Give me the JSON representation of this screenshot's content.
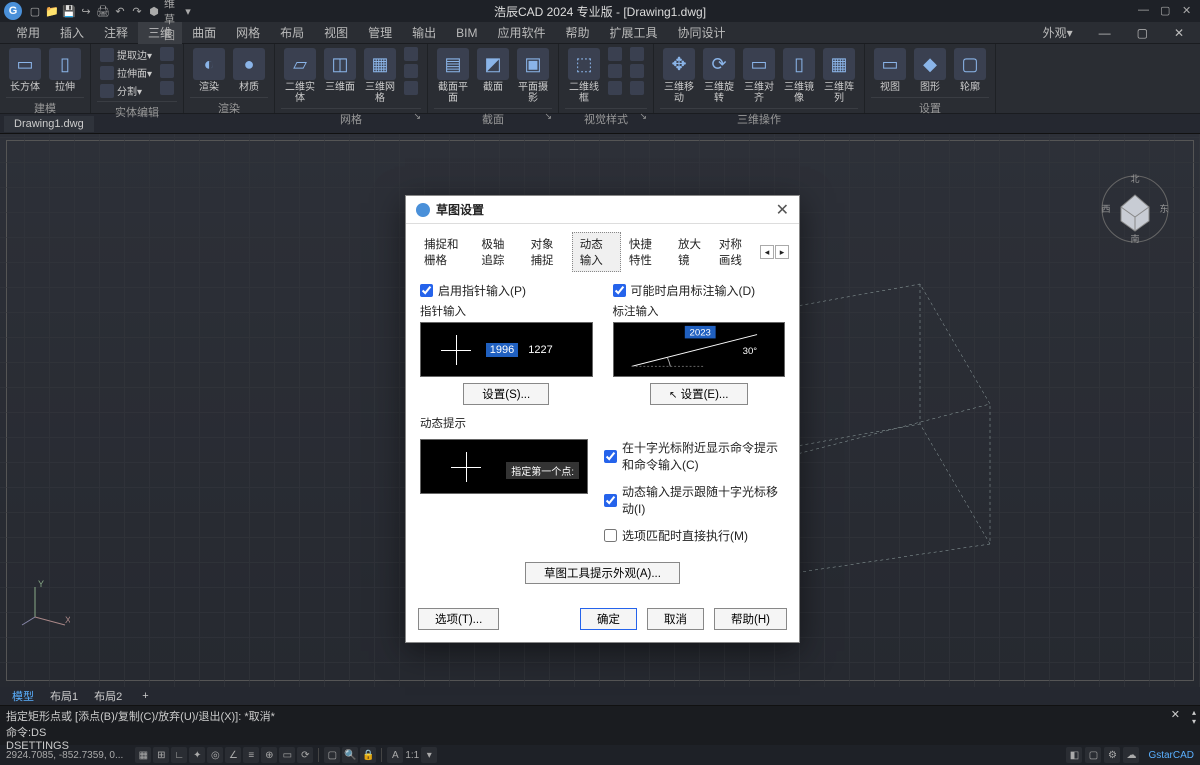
{
  "titlebar": {
    "sketch_mode": "二维草图",
    "app_title": "浩辰CAD 2024 专业版 - [Drawing1.dwg]"
  },
  "menubar": {
    "items": [
      "常用",
      "插入",
      "注释",
      "三维",
      "曲面",
      "网格",
      "布局",
      "视图",
      "管理",
      "输出",
      "BIM",
      "应用软件",
      "帮助",
      "扩展工具",
      "协同设计"
    ],
    "active_index": 3,
    "appearance": "外观▾"
  },
  "ribbon": {
    "groups": [
      {
        "label": "建模",
        "tools": [
          {
            "t": "长方体",
            "big": true
          },
          {
            "t": "拉伸",
            "big": true
          }
        ]
      },
      {
        "label": "实体编辑",
        "tools": [
          {
            "t": "提取边▾"
          },
          {
            "t": "拉伸面▾"
          },
          {
            "t": "分割▾"
          }
        ]
      },
      {
        "label": "渲染",
        "tools": [
          {
            "t": "渲染",
            "big": true
          },
          {
            "t": "材质",
            "big": true
          }
        ]
      },
      {
        "label": "网格",
        "tools": [
          {
            "t": "二维实体",
            "big": true
          },
          {
            "t": "三维面",
            "big": true
          },
          {
            "t": "三维网格",
            "big": true
          }
        ],
        "exp": "↘"
      },
      {
        "label": "截面",
        "tools": [
          {
            "t": "截面平面",
            "big": true
          },
          {
            "t": "截面",
            "big": true
          },
          {
            "t": "平面摄影",
            "big": true
          }
        ],
        "exp": "↘"
      },
      {
        "label": "视觉样式",
        "tools": [
          {
            "t": "二维线框",
            "big": true
          }
        ],
        "exp": "↘"
      },
      {
        "label": "三维操作",
        "tools": [
          {
            "t": "三维移动",
            "big": true
          },
          {
            "t": "三维旋转",
            "big": true
          },
          {
            "t": "三维对齐",
            "big": true
          },
          {
            "t": "三维镜像",
            "big": true
          },
          {
            "t": "三维阵列",
            "big": true
          }
        ]
      },
      {
        "label": "设置",
        "tools": [
          {
            "t": "视图",
            "big": true
          },
          {
            "t": "图形",
            "big": true
          },
          {
            "t": "轮廓",
            "big": true
          }
        ]
      }
    ]
  },
  "doctabs": {
    "items": [
      "Drawing1.dwg"
    ]
  },
  "dialog": {
    "title": "草图设置",
    "tabs": [
      "捕捉和栅格",
      "极轴追踪",
      "对象捕捉",
      "动态输入",
      "快捷特性",
      "放大镜",
      "对称画线"
    ],
    "active_tab": 3,
    "enable_pointer": "启用指针输入(P)",
    "enable_dim": "可能时启用标注输入(D)",
    "pointer_label": "指针输入",
    "dim_label": "标注输入",
    "val1": "1996",
    "val2": "1227",
    "val3": "2023",
    "angle": "30°",
    "settings_s": "设置(S)...",
    "settings_e": "设置(E)...",
    "dyn_prompt_label": "动态提示",
    "prompt_text": "指定第一个点:",
    "chk_crosshair": "在十字光标附近显示命令提示和命令输入(C)",
    "chk_follow": "动态输入提示跟随十字光标移动(I)",
    "chk_match": "选项匹配时直接执行(M)",
    "appearance_btn": "草图工具提示外观(A)...",
    "options_btn": "选项(T)...",
    "ok": "确定",
    "cancel": "取消",
    "help": "帮助(H)"
  },
  "layouttabs": {
    "items": [
      "模型",
      "布局1",
      "布局2"
    ],
    "active": 0
  },
  "cmdline": {
    "line1": "指定矩形点或 [添点(B)/复制(C)/放弃(U)/退出(X)]: *取消*",
    "line2": "命令:DS",
    "line3": "DSETTINGS"
  },
  "statusbar": {
    "coords": "2924.7085, -852.7359, 0...",
    "scale": "1:1",
    "brand": "GstarCAD"
  }
}
